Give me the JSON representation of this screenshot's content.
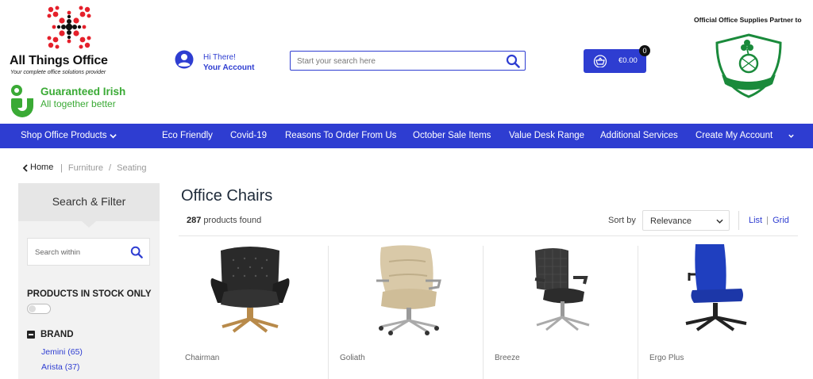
{
  "header": {
    "logo_title": "All Things Office",
    "logo_tagline": "Your complete office solutions provider",
    "guaranteed_title": "Guaranteed Irish",
    "guaranteed_sub": "All together better",
    "account_greeting": "Hi There!",
    "account_link": "Your Account",
    "search_placeholder": "Start your search here",
    "cart_total": "€0.00",
    "cart_count": "0",
    "partner_text": "Official Office Supplies Partner to",
    "brand_color": "#2e3dd1"
  },
  "nav": {
    "items": [
      {
        "label": "Shop Office Products",
        "has_dropdown": true
      },
      {
        "label": "Eco Friendly"
      },
      {
        "label": "Covid-19"
      },
      {
        "label": "Reasons To Order From Us"
      },
      {
        "label": "October Sale Items"
      },
      {
        "label": "Value Desk Range"
      },
      {
        "label": "Additional Services"
      },
      {
        "label": "Create My Account"
      }
    ]
  },
  "breadcrumb": {
    "home": "Home",
    "items": [
      "Furniture",
      "Seating"
    ]
  },
  "sidebar": {
    "title": "Search & Filter",
    "search_placeholder": "Search within",
    "stock_label": "PRODUCTS IN STOCK ONLY",
    "stock_only": false,
    "brand_label": "BRAND",
    "brands": [
      {
        "label": "Jemini (65)"
      },
      {
        "label": "Arista (37)"
      }
    ]
  },
  "main": {
    "title": "Office Chairs",
    "count": "287",
    "count_suffix": "products found",
    "sort_label": "Sort by",
    "sort_value": "Relevance",
    "view_list": "List",
    "view_grid": "Grid",
    "products": [
      {
        "name": "Chairman",
        "icon": "leather-chair-image"
      },
      {
        "name": "Goliath",
        "icon": "beige-chair-image"
      },
      {
        "name": "Breeze",
        "icon": "mesh-chair-image"
      },
      {
        "name": "Ergo Plus",
        "icon": "blue-task-chair-image"
      }
    ]
  }
}
